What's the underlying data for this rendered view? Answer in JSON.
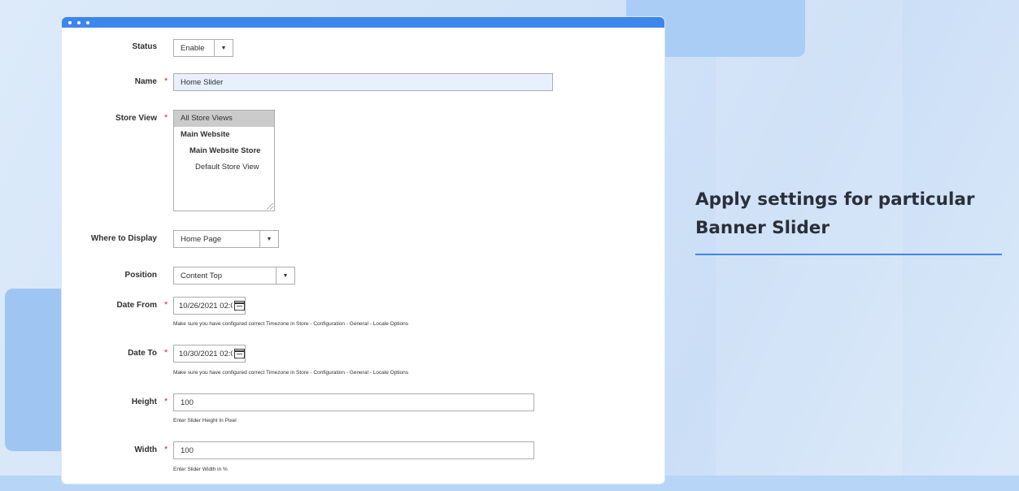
{
  "form": {
    "status": {
      "label": "Status",
      "value": "Enable"
    },
    "name": {
      "label": "Name",
      "required_mark": "*",
      "value": "Home Slider"
    },
    "store_view": {
      "label": "Store View",
      "required_mark": "*",
      "options": [
        "All Store Views",
        "Main Website",
        "Main Website Store",
        "Default Store View"
      ],
      "selected": "All Store Views"
    },
    "where_to_display": {
      "label": "Where to Display",
      "value": "Home Page"
    },
    "position": {
      "label": "Position",
      "value": "Content Top"
    },
    "date_from": {
      "label": "Date From",
      "required_mark": "*",
      "value": "10/26/2021 02:0",
      "hint": "Make sure you have configured correct Timezone in Store - Configuration - General - Locale Options"
    },
    "date_to": {
      "label": "Date To",
      "required_mark": "*",
      "value": "10/30/2021 02:0",
      "hint": "Make sure you have configured correct Timezone in Store - Configuration - General - Locale Options"
    },
    "height": {
      "label": "Height",
      "required_mark": "*",
      "value": "100",
      "hint": "Enter Slider Height In Pixel"
    },
    "width": {
      "label": "Width",
      "required_mark": "*",
      "value": "100",
      "hint": "Enter Slider Width in %"
    }
  },
  "side": {
    "title_line1": "Apply settings for particular",
    "title_line2": "Banner Slider"
  },
  "colors": {
    "accent": "#3d86ee",
    "required": "#e02b27",
    "input_highlight": "#e8f0fe"
  },
  "icons": {
    "dropdown": "chevron-down-icon",
    "calendar": "calendar-icon"
  }
}
